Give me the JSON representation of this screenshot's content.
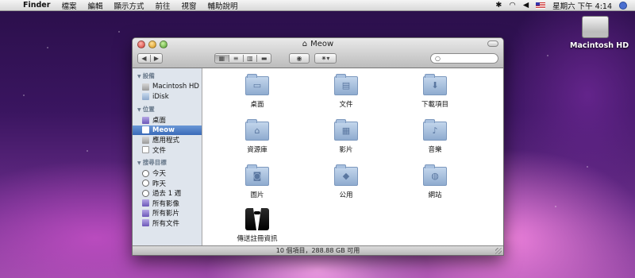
{
  "menubar": {
    "app_name": "Finder",
    "menus": [
      "檔案",
      "編輯",
      "顯示方式",
      "前往",
      "視窗",
      "輔助說明"
    ],
    "clock": "星期六 下午 4:14"
  },
  "desktop": {
    "hd_label": "Macintosh HD"
  },
  "window": {
    "title": "Meow",
    "status": "10 個項目，288.88 GB 可用",
    "search": {
      "placeholder": "",
      "value": ""
    }
  },
  "sidebar": {
    "sections": [
      {
        "title": "設備",
        "items": [
          {
            "label": "Macintosh HD",
            "icon": "hd-icon"
          },
          {
            "label": "iDisk",
            "icon": "idisk-icon"
          }
        ]
      },
      {
        "title": "位置",
        "items": [
          {
            "label": "桌面",
            "icon": "desktop-icon"
          },
          {
            "label": "Meow",
            "icon": "home-icon",
            "selected": true
          },
          {
            "label": "應用程式",
            "icon": "applications-icon"
          },
          {
            "label": "文件",
            "icon": "documents-icon"
          }
        ]
      },
      {
        "title": "搜尋目標",
        "items": [
          {
            "label": "今天",
            "icon": "clock-icon"
          },
          {
            "label": "昨天",
            "icon": "clock-icon"
          },
          {
            "label": "過去 1 週",
            "icon": "clock-icon"
          },
          {
            "label": "所有影像",
            "icon": "smart-folder-icon"
          },
          {
            "label": "所有影片",
            "icon": "smart-folder-icon"
          },
          {
            "label": "所有文件",
            "icon": "smart-folder-icon"
          }
        ]
      }
    ]
  },
  "items": [
    {
      "label": "桌面",
      "icon": "desktop-folder-icon"
    },
    {
      "label": "文件",
      "icon": "documents-folder-icon"
    },
    {
      "label": "下載項目",
      "icon": "downloads-folder-icon"
    },
    {
      "label": "資源庫",
      "icon": "library-folder-icon"
    },
    {
      "label": "影片",
      "icon": "movies-folder-icon"
    },
    {
      "label": "音樂",
      "icon": "music-folder-icon"
    },
    {
      "label": "圖片",
      "icon": "pictures-folder-icon"
    },
    {
      "label": "公用",
      "icon": "public-folder-icon"
    },
    {
      "label": "網站",
      "icon": "sites-folder-icon"
    },
    {
      "label": "傳送註冊資訊",
      "icon": "tuxedo-icon"
    }
  ]
}
